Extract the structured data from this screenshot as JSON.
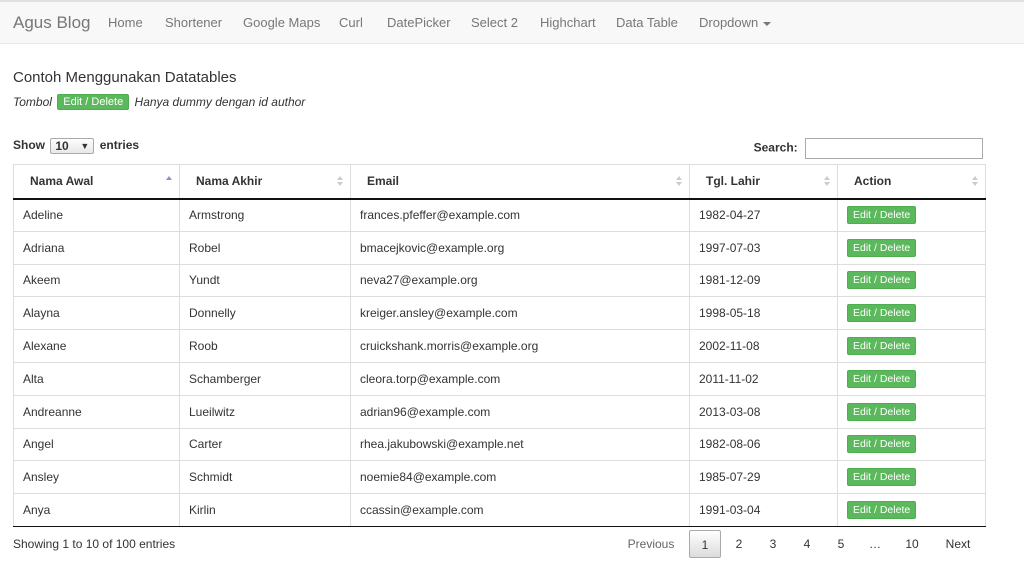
{
  "navbar": {
    "brand": "Agus Blog",
    "items": [
      "Home",
      "Shortener",
      "Google Maps",
      "Curl",
      "DatePicker",
      "Select 2",
      "Highchart",
      "Data Table",
      "Dropdown"
    ]
  },
  "heading": {
    "title": "Contoh Menggunakan Datatables",
    "prefix": "Tombol",
    "tag": "Edit / Delete",
    "suffix": "Hanya dummy dengan id author"
  },
  "controls": {
    "show_label": "Show",
    "entries_value": "10",
    "entries_label": "entries",
    "search_label": "Search:",
    "search_value": ""
  },
  "table": {
    "columns": [
      "Nama Awal",
      "Nama Akhir",
      "Email",
      "Tgl. Lahir",
      "Action"
    ],
    "action_label": "Edit / Delete",
    "rows": [
      [
        "Adeline",
        "Armstrong",
        "frances.pfeffer@example.com",
        "1982-04-27"
      ],
      [
        "Adriana",
        "Robel",
        "bmacejkovic@example.org",
        "1997-07-03"
      ],
      [
        "Akeem",
        "Yundt",
        "neva27@example.org",
        "1981-12-09"
      ],
      [
        "Alayna",
        "Donnelly",
        "kreiger.ansley@example.com",
        "1998-05-18"
      ],
      [
        "Alexane",
        "Roob",
        "cruickshank.morris@example.org",
        "2002-11-08"
      ],
      [
        "Alta",
        "Schamberger",
        "cleora.torp@example.com",
        "2011-11-02"
      ],
      [
        "Andreanne",
        "Lueilwitz",
        "adrian96@example.com",
        "2013-03-08"
      ],
      [
        "Angel",
        "Carter",
        "rhea.jakubowski@example.net",
        "1982-08-06"
      ],
      [
        "Ansley",
        "Schmidt",
        "noemie84@example.com",
        "1985-07-29"
      ],
      [
        "Anya",
        "Kirlin",
        "ccassin@example.com",
        "1991-03-04"
      ]
    ]
  },
  "footer": {
    "info": "Showing 1 to 10 of 100 entries",
    "previous": "Previous",
    "pages": [
      "1",
      "2",
      "3",
      "4",
      "5",
      "…",
      "10"
    ],
    "current": "1",
    "next": "Next"
  }
}
